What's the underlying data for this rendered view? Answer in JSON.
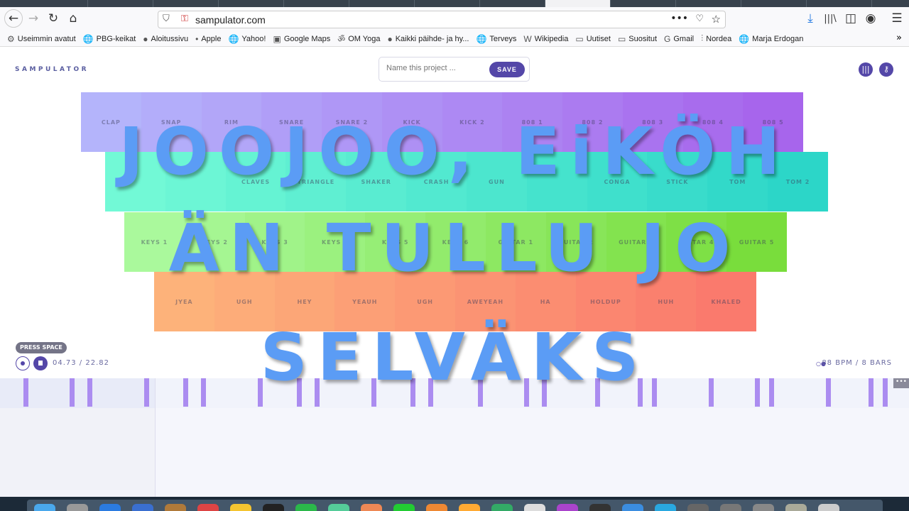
{
  "browser": {
    "url": "sampulator.com",
    "bookmarks": [
      {
        "label": "Useimmin avatut",
        "icon": "gear-icon"
      },
      {
        "label": "PBG-keikat",
        "icon": "globe-icon"
      },
      {
        "label": "Aloitussivu",
        "icon": "firefox-icon"
      },
      {
        "label": "Apple",
        "icon": "apple-icon"
      },
      {
        "label": "Yahoo!",
        "icon": "globe-icon"
      },
      {
        "label": "Google Maps",
        "icon": "maps-icon"
      },
      {
        "label": "OM Yoga",
        "icon": "om-icon"
      },
      {
        "label": "Kaikki päihde- ja hy...",
        "icon": "mll-icon"
      },
      {
        "label": "Terveys",
        "icon": "globe-icon"
      },
      {
        "label": "Wikipedia",
        "icon": "wikipedia-icon"
      },
      {
        "label": "Uutiset",
        "icon": "folder-icon"
      },
      {
        "label": "Suositut",
        "icon": "folder-icon"
      },
      {
        "label": "Gmail",
        "icon": "google-icon"
      },
      {
        "label": "Nordea",
        "icon": "nordea-icon"
      },
      {
        "label": "Marja Erdogan",
        "icon": "globe-icon"
      }
    ]
  },
  "app": {
    "logo": "SAMPULATOR",
    "project_placeholder": "Name this project ...",
    "save_label": "SAVE",
    "tooltip": "PRESS SPACE",
    "time": "04.73 / 22.82",
    "tempo": "88 BPM / 8 BARS",
    "more_label": "•••"
  },
  "pads": {
    "row1": [
      "CLAP",
      "SNAP",
      "RIM",
      "SNARE",
      "SNARE 2",
      "KICK",
      "KICK 2",
      "808 1",
      "808 2",
      "808 3",
      "808 4",
      "808 5"
    ],
    "row2": [
      "",
      "",
      "CLAVES",
      "TRIANGLE",
      "SHAKER",
      "CRASH",
      "GUN",
      "",
      "CONGA",
      "STICK",
      "TOM",
      "TOM 2"
    ],
    "row3": [
      "KEYS 1",
      "KEYS 2",
      "KEYS 3",
      "KEYS 4",
      "KEYS 5",
      "KEYS 6",
      "GUITAR 1",
      "GUITAR 2",
      "GUITAR 3",
      "GUITAR 4",
      "GUITAR 5"
    ],
    "row4": [
      "JYEA",
      "UGH",
      "HEY",
      "YEAUH",
      "UGH",
      "AWEYEAH",
      "HA",
      "HOLDUP",
      "HUH",
      "KHALED"
    ]
  },
  "colors": {
    "accent": "#5447a8",
    "row1": [
      "#b4b4fb",
      "#a765ec"
    ],
    "row2": [
      "#72f9d6",
      "#2cd6c8"
    ],
    "row3": [
      "#aaf99c",
      "#79dd3c"
    ],
    "row4": [
      "#fdb27a",
      "#fa7a6d"
    ],
    "caption": "#5b9cf5"
  },
  "caption": {
    "line1": "JOOJOO, EiKÖH",
    "line2": "ÄN TULLU JO",
    "line3": "SELVÄKS"
  }
}
